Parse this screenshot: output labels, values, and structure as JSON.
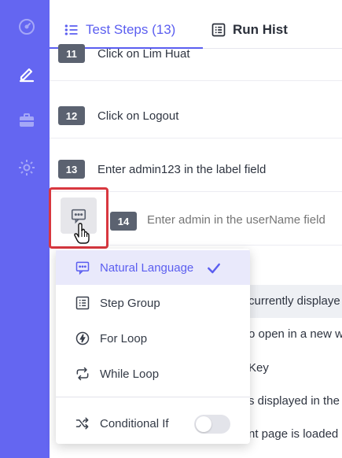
{
  "sidebar": {
    "icons": [
      "dashboard-icon",
      "edit-icon",
      "briefcase-icon",
      "settings-icon"
    ],
    "accent": "#6466f1"
  },
  "tabs": [
    {
      "label": "Test Steps (13)",
      "icon": "list-icon",
      "active": true
    },
    {
      "label": "Run Hist",
      "icon": "history-list-icon",
      "active": false
    }
  ],
  "steps": [
    {
      "num": "11",
      "text": "Click on Lim Huat"
    },
    {
      "num": "12",
      "text": "Click on Logout"
    },
    {
      "num": "13",
      "text": "Enter admin123 in the label field"
    }
  ],
  "new_step": {
    "num": "14",
    "placeholder": "Enter admin in the userName field"
  },
  "background_rows": [
    "currently displaye",
    "o open in a new w",
    "Key",
    "s displayed in the",
    "nt page is loaded"
  ],
  "menu": {
    "items": [
      {
        "label": "Natural Language",
        "icon": "chat-icon",
        "selected": true
      },
      {
        "label": "Step Group",
        "icon": "step-group-icon",
        "selected": false
      },
      {
        "label": "For Loop",
        "icon": "lightning-icon",
        "selected": false
      },
      {
        "label": "While Loop",
        "icon": "loop-icon",
        "selected": false
      }
    ],
    "conditional": {
      "label": "Conditional If",
      "icon": "shuffle-icon",
      "enabled": false
    }
  },
  "colors": {
    "accent": "#5b5ef0",
    "highlight_border": "#d8373f"
  }
}
